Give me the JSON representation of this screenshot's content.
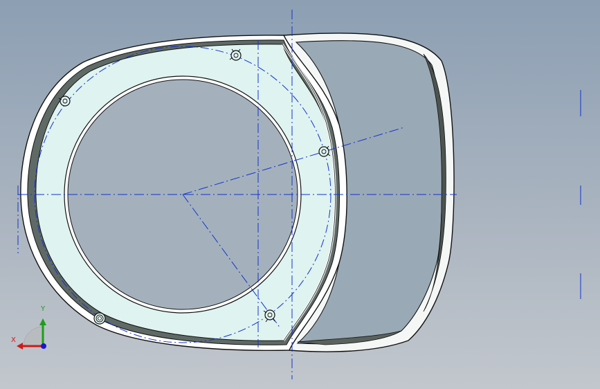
{
  "viewport": {
    "background_top": "#8c9fb3",
    "background_bottom": "#c2c7cd"
  },
  "model": {
    "part_fill": "#dff3f0",
    "edge_color": "#1a1a1a",
    "rim_dark": "#4c5450",
    "rim_light": "#ffffff",
    "construction_color": "#1233cc",
    "mounting_hole_icon": "ring-boss-icon"
  },
  "triad": {
    "x_label": "X",
    "y_label": "Y",
    "x_color": "#d01818",
    "y_color": "#1aa01a",
    "z_color": "#1818d0"
  }
}
